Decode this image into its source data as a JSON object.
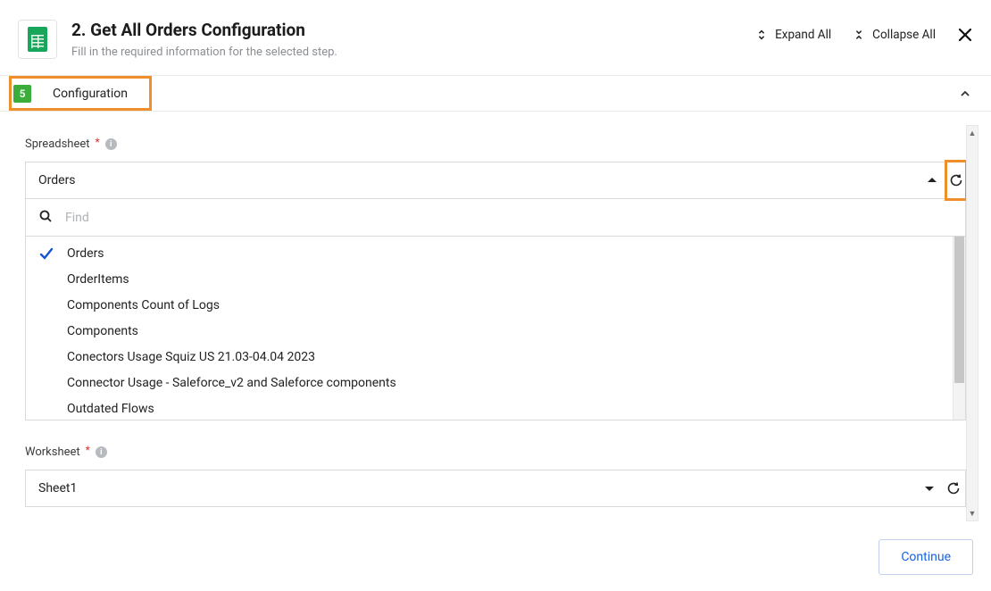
{
  "header": {
    "title": "2. Get All Orders Configuration",
    "subtitle": "Fill in the required information for the selected step.",
    "expand_all": "Expand All",
    "collapse_all": "Collapse All"
  },
  "section": {
    "badge_number": "5",
    "title": "Configuration"
  },
  "spreadsheet": {
    "label": "Spreadsheet",
    "selected": "Orders",
    "find_placeholder": "Find",
    "options": [
      {
        "label": "Orders",
        "selected": true
      },
      {
        "label": "OrderItems",
        "selected": false
      },
      {
        "label": "Components Count of Logs",
        "selected": false
      },
      {
        "label": "Components",
        "selected": false
      },
      {
        "label": "Conectors Usage Squiz US 21.03-04.04 2023",
        "selected": false
      },
      {
        "label": "Connector Usage - Saleforce_v2 and Saleforce components",
        "selected": false
      },
      {
        "label": "Outdated Flows",
        "selected": false
      }
    ]
  },
  "worksheet": {
    "label": "Worksheet",
    "selected": "Sheet1"
  },
  "footer": {
    "continue": "Continue"
  },
  "colors": {
    "accent_green": "#18a65a",
    "highlight_orange": "#f08f2a",
    "link_blue": "#1862e5",
    "check_blue": "#1653d4"
  }
}
